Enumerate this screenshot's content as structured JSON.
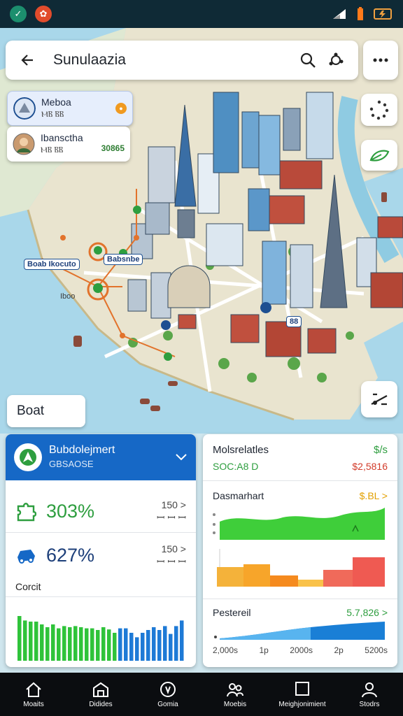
{
  "header": {
    "title": "Sunulaazia"
  },
  "places": [
    {
      "name": "Meboa",
      "sub": "ⲘⲂ ⲂⲂ",
      "badge": "●"
    },
    {
      "name": "Ibansctha",
      "sub": "ⲘⲂ ⲂⲂ",
      "value": "30865"
    }
  ],
  "map": {
    "labels": [
      "Boab Ikocuto",
      "Babsnbe",
      "Iboo"
    ],
    "marker_label": "88",
    "boat_label": "Boat"
  },
  "left_panel": {
    "title": "Bubdolejmert",
    "subtitle": "GBSAOSE",
    "stats": [
      {
        "value": "303%",
        "side1": "150 >",
        "side2": "ꟷ ꟷ ꟷ"
      },
      {
        "value": "627%",
        "side1": "150 >",
        "side2": "ꟷ ꟷ ꟷ"
      }
    ],
    "caption": "Corcit",
    "bar_values": [
      0.8,
      0.72,
      0.7,
      0.7,
      0.65,
      0.6,
      0.65,
      0.58,
      0.62,
      0.6,
      0.62,
      0.6,
      0.58,
      0.58,
      0.55,
      0.6,
      0.56,
      0.5,
      0.58,
      0.58,
      0.5,
      0.42,
      0.5,
      0.55,
      0.6,
      0.55,
      0.62,
      0.48,
      0.62,
      0.72
    ]
  },
  "right_panel": {
    "title": "Molsrelatles",
    "title_side": "$/s",
    "sub": "SOC:A8 D",
    "sub_side": "$2,5816",
    "chart1_title": "Dasmarhart",
    "chart1_side": "$.BL >",
    "chart2_title": "Pestereil",
    "chart2_side": "5.7,826 >",
    "axis_labels": [
      "2,000s",
      "1p",
      "2000s",
      "2p",
      "5200s"
    ]
  },
  "nav": [
    {
      "label": "Moaits",
      "icon": "home-icon"
    },
    {
      "label": "Didides",
      "icon": "building-icon"
    },
    {
      "label": "Gomia",
      "icon": "compass-icon"
    },
    {
      "label": "Moebis",
      "icon": "group-icon"
    },
    {
      "label": "Meighjonimient",
      "icon": "square-icon"
    },
    {
      "label": "Stodrs",
      "icon": "profile-icon"
    }
  ],
  "colors": {
    "accent": "#1668c6",
    "green": "#2e9e3f",
    "status_bar": "#0f2a36"
  }
}
